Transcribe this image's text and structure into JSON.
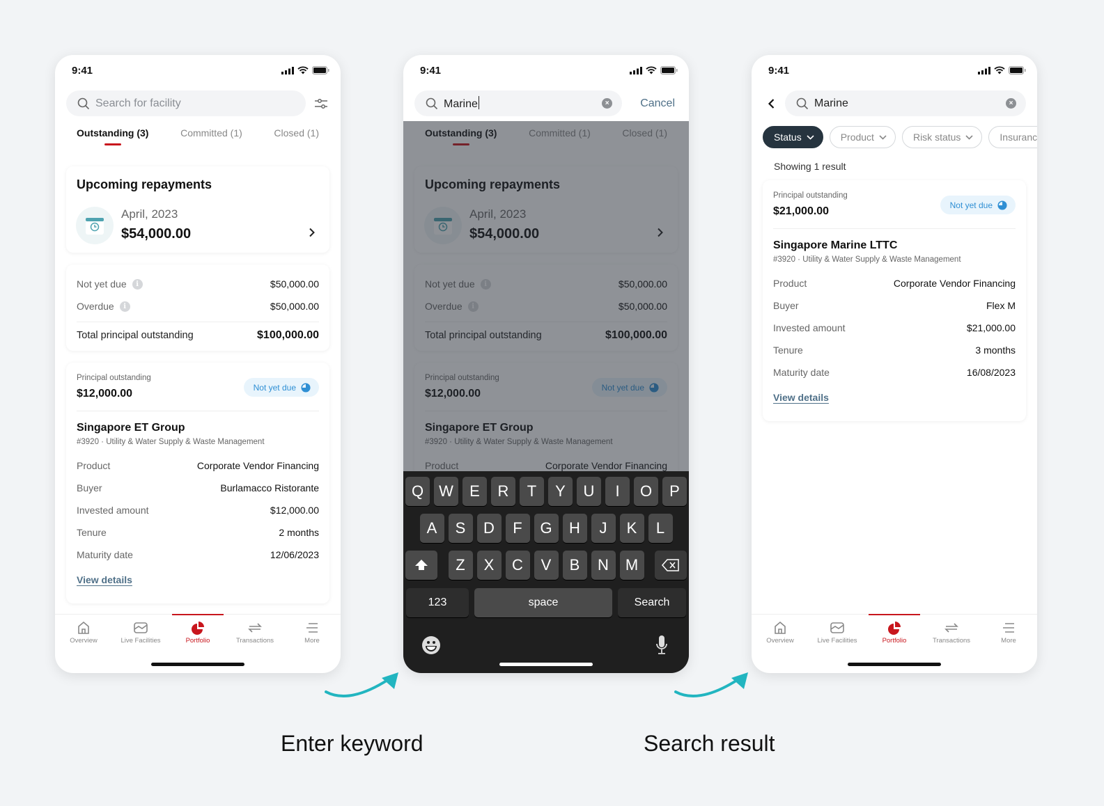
{
  "status_bar": {
    "time": "9:41"
  },
  "tabs": [
    {
      "label": "Outstanding (3)"
    },
    {
      "label": "Committed (1)"
    },
    {
      "label": "Closed (1)"
    }
  ],
  "bottom_nav": [
    {
      "label": "Overview",
      "icon": "home-icon"
    },
    {
      "label": "Live Facilities",
      "icon": "chart-area-icon"
    },
    {
      "label": "Portfolio",
      "icon": "pie-chart-icon",
      "active": true
    },
    {
      "label": "Transactions",
      "icon": "swap-arrows-icon"
    },
    {
      "label": "More",
      "icon": "menu-icon"
    }
  ],
  "screen1": {
    "search_placeholder": "Search for facility",
    "upcoming": {
      "title": "Upcoming repayments",
      "month": "April, 2023",
      "amount": "$54,000.00"
    },
    "summary": {
      "not_yet_due_label": "Not yet due",
      "not_yet_due_value": "$50,000.00",
      "overdue_label": "Overdue",
      "overdue_value": "$50,000.00",
      "total_label": "Total principal outstanding",
      "total_value": "$100,000.00"
    },
    "facility": {
      "po_label": "Principal outstanding",
      "po_amount": "$12,000.00",
      "badge": "Not yet due",
      "name": "Singapore ET Group",
      "sub": "#3920  ·  Utility & Water Supply & Waste Management",
      "rows": [
        {
          "label": "Product",
          "value": "Corporate Vendor Financing"
        },
        {
          "label": "Buyer",
          "value": "Burlamacco Ristorante"
        },
        {
          "label": "Invested amount",
          "value": "$12,000.00"
        },
        {
          "label": "Tenure",
          "value": "2 months"
        },
        {
          "label": "Maturity date",
          "value": "12/06/2023"
        }
      ],
      "view_details": "View details"
    }
  },
  "screen2": {
    "search_value": "Marine",
    "cancel_label": "Cancel",
    "keyboard": {
      "row1": [
        "Q",
        "W",
        "E",
        "R",
        "T",
        "Y",
        "U",
        "I",
        "O",
        "P"
      ],
      "row2": [
        "A",
        "S",
        "D",
        "F",
        "G",
        "H",
        "J",
        "K",
        "L"
      ],
      "row3": [
        "Z",
        "X",
        "C",
        "V",
        "B",
        "N",
        "M"
      ],
      "num_label": "123",
      "space_label": "space",
      "search_label": "Search"
    }
  },
  "screen3": {
    "search_value": "Marine",
    "chips": [
      {
        "label": "Status",
        "active": true
      },
      {
        "label": "Product"
      },
      {
        "label": "Risk status"
      },
      {
        "label": "Insurance"
      }
    ],
    "result_count": "Showing 1 result",
    "facility": {
      "po_label": "Principal outstanding",
      "po_amount": "$21,000.00",
      "badge": "Not yet due",
      "name": "Singapore Marine LTTC",
      "sub": "#3920  ·  Utility & Water Supply & Waste Management",
      "rows": [
        {
          "label": "Product",
          "value": "Corporate Vendor Financing"
        },
        {
          "label": "Buyer",
          "value": "Flex M"
        },
        {
          "label": "Invested amount",
          "value": "$21,000.00"
        },
        {
          "label": "Tenure",
          "value": "3 months"
        },
        {
          "label": "Maturity date",
          "value": "16/08/2023"
        }
      ],
      "view_details": "View details"
    }
  },
  "captions": {
    "step1": "Enter keyword",
    "step2": "Search result"
  },
  "colors": {
    "brand_red": "#c8161d",
    "accent_teal": "#22b5c0",
    "badge_blue": "#2f8fd4",
    "link": "#4f7088",
    "chip_active": "#26343f"
  }
}
